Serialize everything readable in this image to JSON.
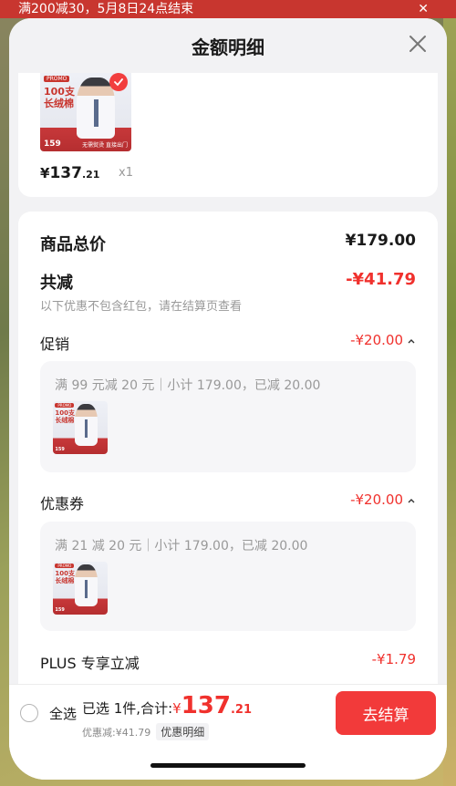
{
  "background": {
    "banner_text": "满200减30，5月8日24点结束",
    "banner_close": "✕"
  },
  "sheet": {
    "title": "金额明细"
  },
  "product": {
    "price_symbol": "¥",
    "price_int": "137",
    "price_dec": ".21",
    "quantity": "x1",
    "thumb": {
      "badge": "PROMO",
      "text_line1": "100支",
      "text_line2": "长绒棉",
      "price": "159",
      "button": "无需熨烫 直接出门"
    }
  },
  "summary": {
    "total_label": "商品总价",
    "total_value": "¥179.00",
    "discount_label": "共减",
    "discount_value": "-¥41.79",
    "discount_note": "以下优惠不包含红包，请在结算页查看"
  },
  "promotion": {
    "label": "促销",
    "value": "-¥20.00",
    "rule": "满 99 元减 20 元｜小计 179.00，已减 20.00"
  },
  "coupon": {
    "label": "优惠券",
    "value": "-¥20.00",
    "rule": "满 21 减 20 元｜小计 179.00，已减 20.00"
  },
  "plus": {
    "label": "PLUS 专享立减",
    "value": "-¥1.79"
  },
  "footer": {
    "select_all": "全选",
    "selected_text": "已选 1件,合计:",
    "total_symbol": "¥",
    "total_int": "137",
    "total_dec": ".21",
    "discount_line": "优惠减:¥41.79",
    "discount_detail": "优惠明细",
    "checkout": "去结算"
  },
  "colors": {
    "accent": "#f0312d",
    "checkout_button": "#f23a3a"
  }
}
